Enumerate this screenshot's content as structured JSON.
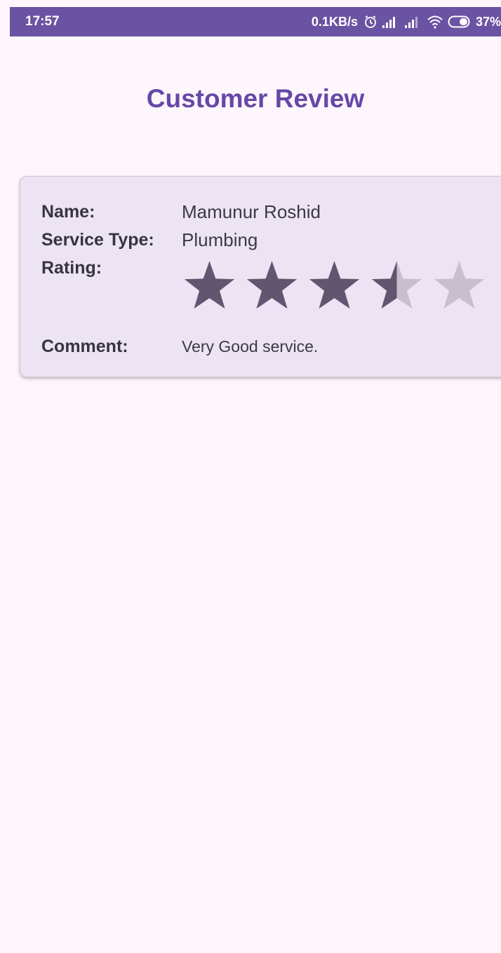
{
  "status_bar": {
    "time": "17:57",
    "net_speed": "0.1KB/s",
    "battery": "37%",
    "icons": [
      "alarm-icon",
      "signal-icon",
      "signal-icon",
      "wifi-icon",
      "battery-icon"
    ]
  },
  "page": {
    "title": "Customer Review"
  },
  "review": {
    "name_label": "Name:",
    "name_value": "Mamunur Roshid",
    "service_label": "Service Type:",
    "service_value": "Plumbing",
    "rating_label": "Rating:",
    "rating_value": 3.5,
    "rating_max": 5,
    "comment_label": "Comment:",
    "comment_value": "Very Good service."
  },
  "colors": {
    "status_bar_bg": "#6b53a3",
    "title": "#6648a6",
    "card_bg": "#ece4f3",
    "star_filled": "#605670",
    "star_empty": "#c7bfcd"
  }
}
